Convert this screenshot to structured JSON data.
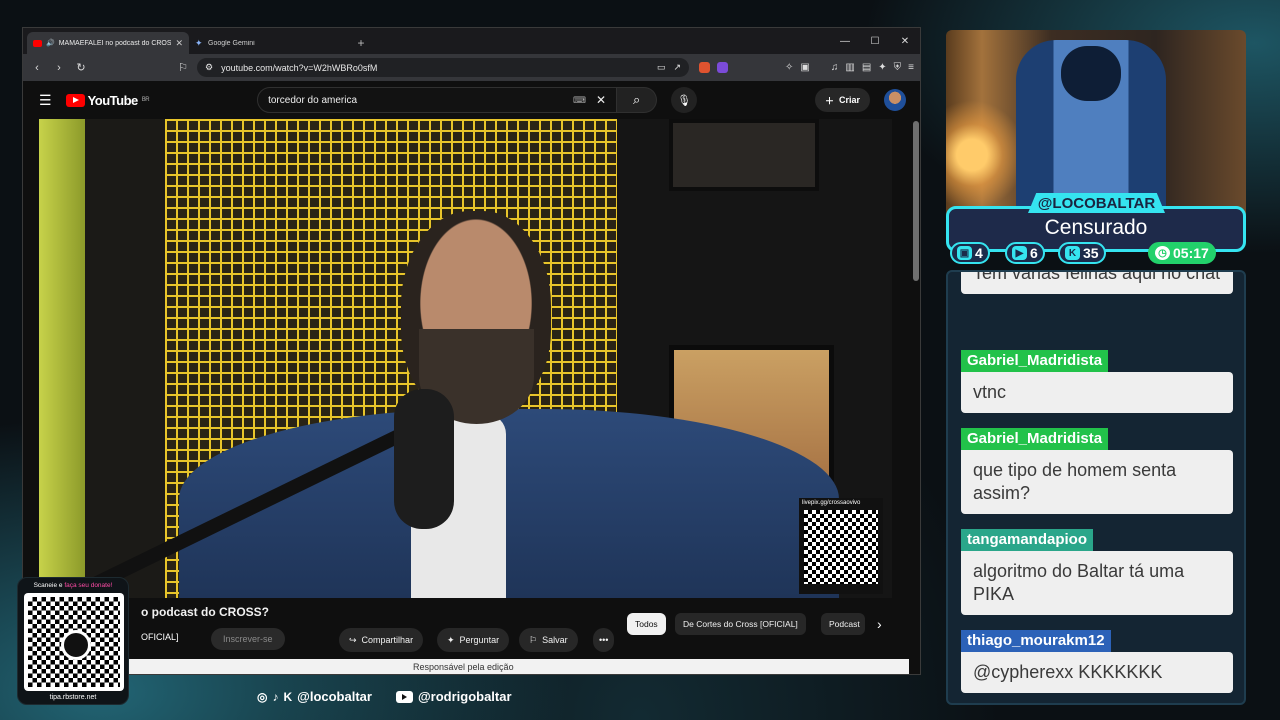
{
  "browser": {
    "tabs": [
      {
        "label": "MAMAEFALEI no podcast do CROSS",
        "icon": "youtube-icon",
        "active": true
      },
      {
        "label": "Google Gemini",
        "icon": "gemini-icon",
        "active": false
      }
    ],
    "url": "youtube.com/watch?v=W2hWBRo0sfM"
  },
  "youtube": {
    "logo_text": "YouTube",
    "region": "BR",
    "search_query": "torcedor do america",
    "create_label": "Criar",
    "video_title": "o podcast do CROSS?",
    "channel": "OFICIAL]",
    "subscribe_label": "Inscrever-se",
    "actions": {
      "share": "Compartilhar",
      "ask": "Perguntar",
      "save": "Salvar"
    },
    "chips": [
      "Todos",
      "De Cortes do Cross [OFICIAL]",
      "Podcast"
    ],
    "editor_note": "Responsável pela edição",
    "overlay_qr_label": "livepix.gg/crossaovivo"
  },
  "donate": {
    "prefix": "Scaneie e",
    "highlight": "faça seu donate!",
    "url": "tipa.rbstore.net"
  },
  "socials": {
    "handle1": "@locobaltar",
    "handle2": "@rodrigobaltar"
  },
  "streamer": {
    "handle": "@LOCOBALTAR",
    "status": "Censurado",
    "stats": {
      "twitch": "4",
      "youtube": "6",
      "kick": "35",
      "time": "05:17"
    },
    "accent": "#35e4f0"
  },
  "chat": {
    "messages": [
      {
        "name": "",
        "text": "Tem várias felinas aqui no chat",
        "color": ""
      },
      {
        "name": "Gabriel_Madridista",
        "text": "vtnc",
        "color": "#22c24a"
      },
      {
        "name": "Gabriel_Madridista",
        "text": "que tipo de homem senta assim?",
        "color": "#22c24a"
      },
      {
        "name": "tangamandapioo",
        "text": "algoritmo do Baltar tá uma PIKA",
        "color": "#2aa68a"
      },
      {
        "name": "thiago_mourakm12",
        "text": "@cypherexx KKKKKKK",
        "color": "#2c62b8"
      }
    ]
  }
}
